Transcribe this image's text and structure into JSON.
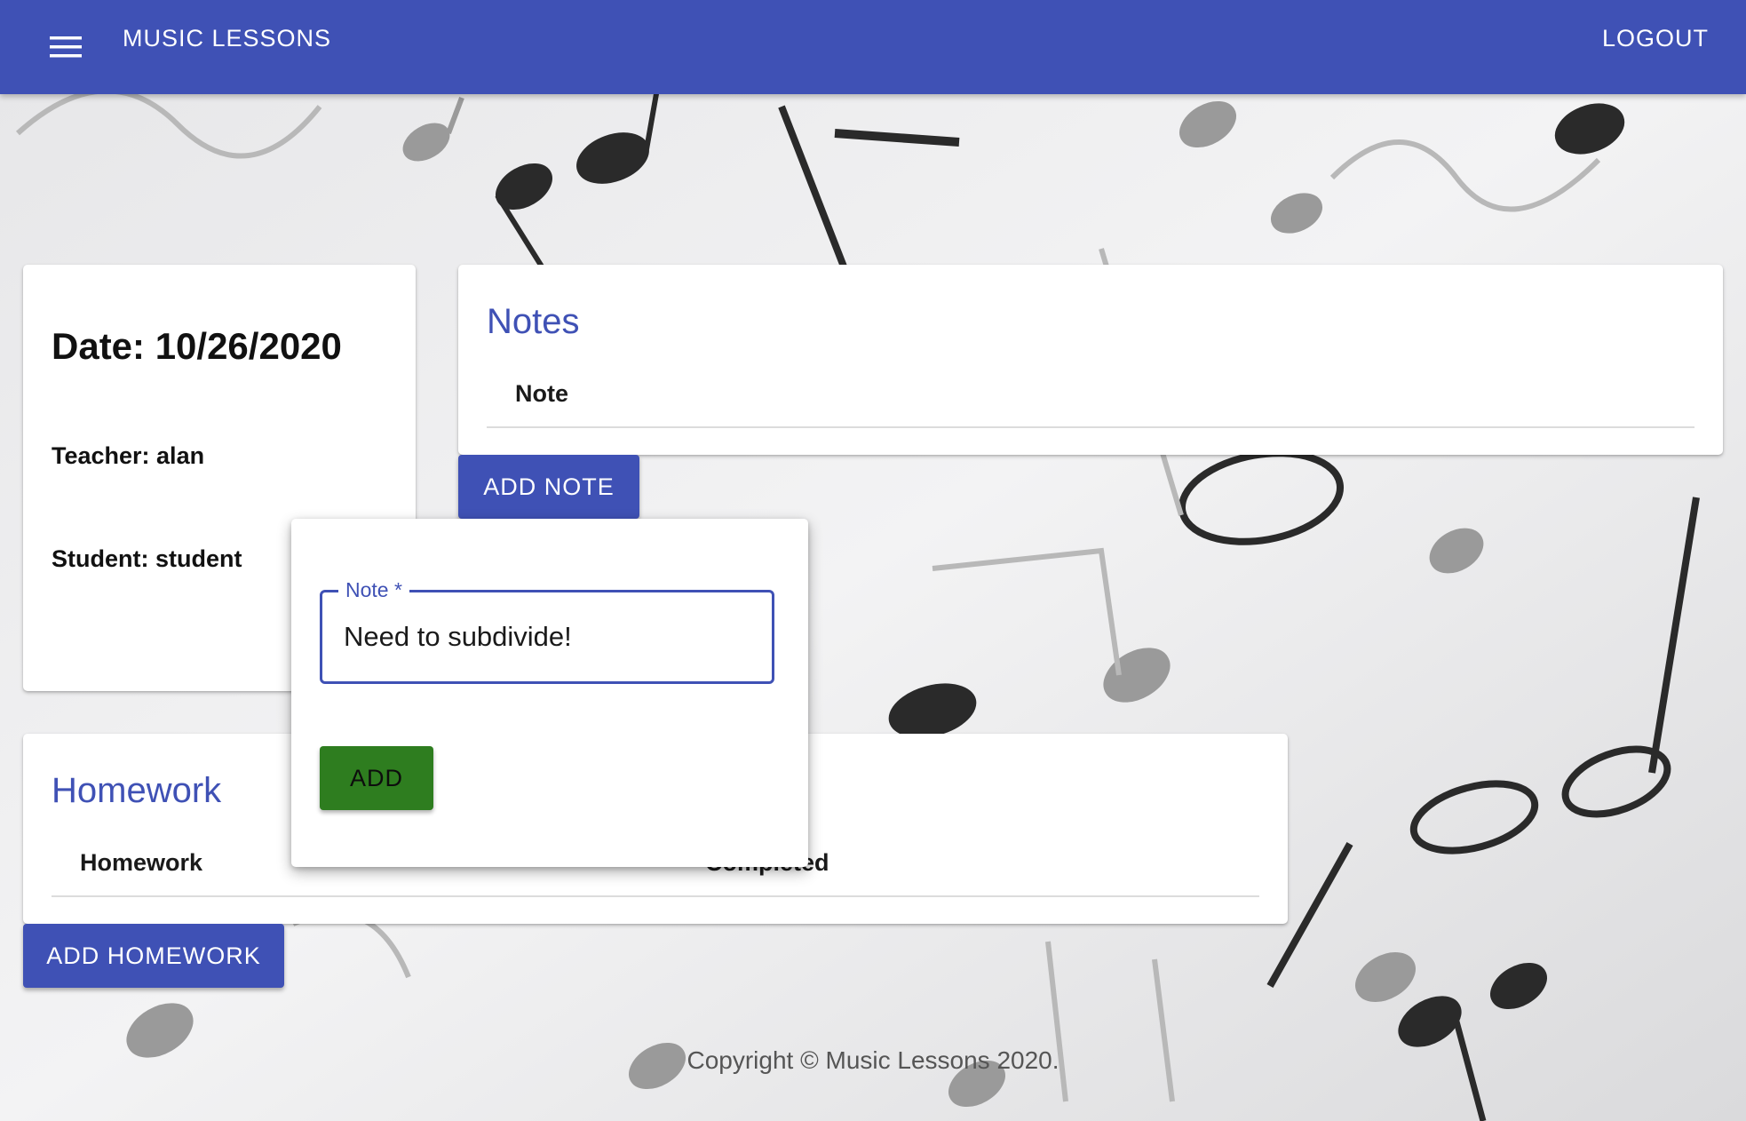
{
  "appbar": {
    "title": "MUSIC LESSONS",
    "logout_label": "LOGOUT",
    "menu_icon": "hamburger-menu-icon",
    "color": "#3f51b5"
  },
  "lesson": {
    "date_text": "Date: 10/26/2020",
    "teacher_text": "Teacher: alan",
    "student_text": "Student: student"
  },
  "notes": {
    "title": "Notes",
    "column_header": "Note",
    "add_button_label": "ADD NOTE"
  },
  "homework": {
    "title": "Homework",
    "columns": [
      "Homework",
      "Completed"
    ],
    "add_button_label": "ADD HOMEWORK"
  },
  "add_note_popover": {
    "field_label": "Note *",
    "field_value": "Need to subdivide!",
    "add_button_label": "ADD",
    "add_button_color": "#2e7d1f"
  },
  "footer": {
    "copyright": "Copyright © Music Lessons 2020."
  }
}
